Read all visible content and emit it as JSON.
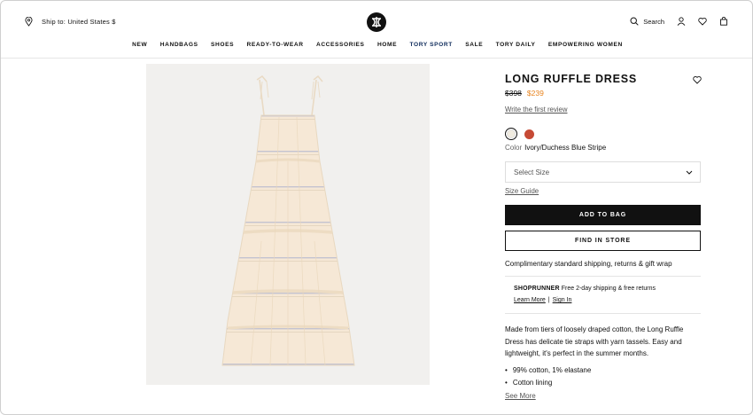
{
  "header": {
    "ship_to": "Ship to: United States $",
    "search_label": "Search"
  },
  "nav": {
    "items": [
      {
        "label": "NEW"
      },
      {
        "label": "HANDBAGS"
      },
      {
        "label": "SHOES"
      },
      {
        "label": "READY-TO-WEAR"
      },
      {
        "label": "ACCESSORIES"
      },
      {
        "label": "HOME"
      },
      {
        "label": "TORY SPORT"
      },
      {
        "label": "SALE"
      },
      {
        "label": "TORY DAILY"
      },
      {
        "label": "EMPOWERING WOMEN"
      }
    ]
  },
  "product": {
    "title": "LONG RUFFLE DRESS",
    "price_original": "$398",
    "price_sale": "$239",
    "review_link": "Write the first review",
    "color_label": "Color",
    "color_value": "Ivory/Duchess Blue Stripe",
    "swatches": [
      {
        "name": "Ivory/Duchess Blue Stripe",
        "color": "#f1ece0"
      },
      {
        "name": "Red",
        "color": "#c64a35"
      }
    ],
    "size_placeholder": "Select Size",
    "size_guide": "Size Guide",
    "add_to_bag": "ADD TO BAG",
    "find_in_store": "FIND IN STORE",
    "shipping_note": "Complimentary standard shipping, returns & gift wrap",
    "shoprunner_brand": "SHOPRUNNER",
    "shoprunner_text": "Free 2-day shipping & free returns",
    "learn_more": "Learn More",
    "separator": "|",
    "sign_in": "Sign In",
    "description": "Made from tiers of loosely draped cotton, the Long Ruffle Dress has delicate tie straps with yarn tassels. Easy and lightweight, it's perfect in the summer months.",
    "bullets": [
      "99% cotton, 1% elastane",
      "Cotton lining"
    ],
    "see_more": "See More"
  },
  "colors": {
    "sale_price": "#e8821b",
    "button_bg": "#111111",
    "nav_sport": "#0d2a5a",
    "image_bg": "#f1f0ee"
  }
}
